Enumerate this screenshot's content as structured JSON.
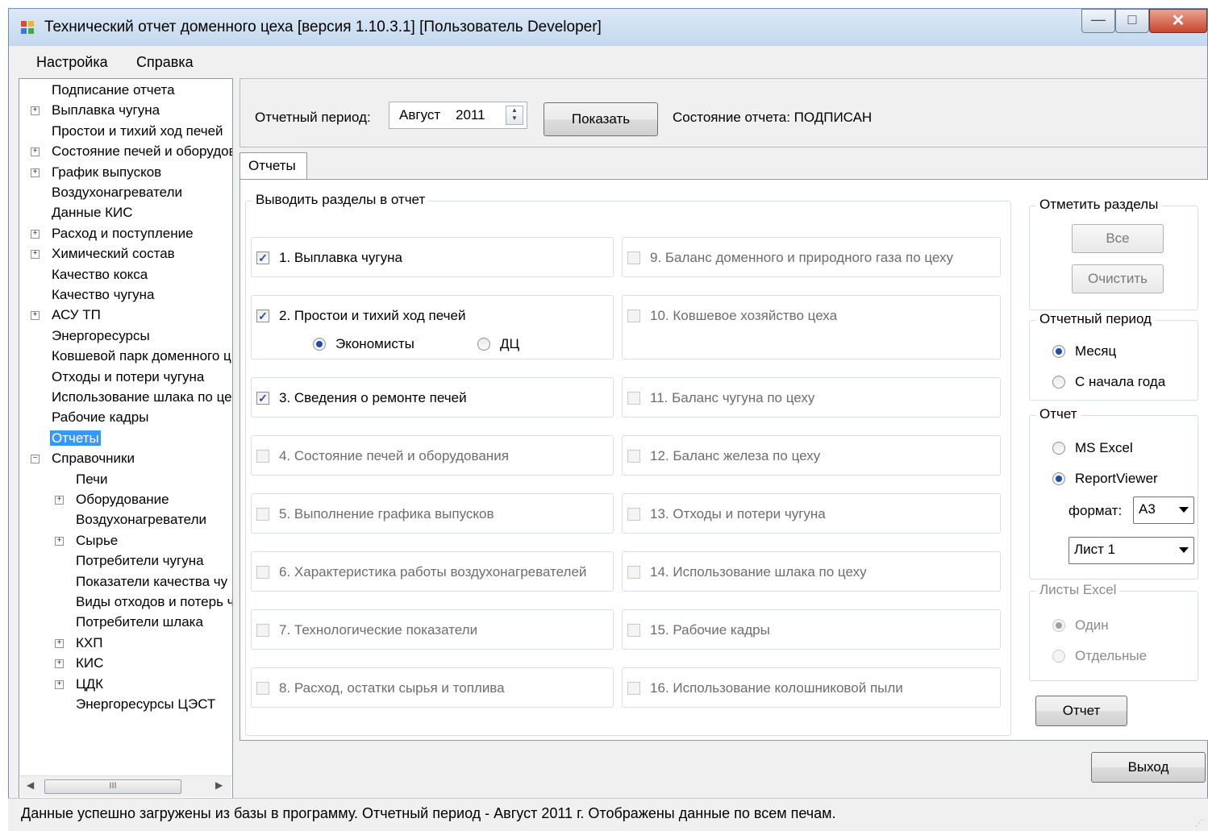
{
  "window": {
    "title": "Технический отчет доменного цеха [версия 1.10.3.1] [Пользователь Developer]",
    "controls": {
      "minimize": "—",
      "maximize": "□",
      "close": "✕"
    }
  },
  "menu": [
    "Настройка",
    "Справка"
  ],
  "tree": {
    "nodes": [
      {
        "label": "Подписание отчета",
        "expander": ""
      },
      {
        "label": "Выплавка чугуна",
        "expander": "+"
      },
      {
        "label": "Простои и тихий ход печей",
        "expander": ""
      },
      {
        "label": "Состояние печей и оборудова",
        "expander": "+"
      },
      {
        "label": "График выпусков",
        "expander": "+"
      },
      {
        "label": "Воздухонагреватели",
        "expander": ""
      },
      {
        "label": "Данные КИС",
        "expander": ""
      },
      {
        "label": "Расход и поступление",
        "expander": "+"
      },
      {
        "label": "Химический состав",
        "expander": "+"
      },
      {
        "label": "Качество кокса",
        "expander": ""
      },
      {
        "label": "Качество чугуна",
        "expander": ""
      },
      {
        "label": "АСУ ТП",
        "expander": "+"
      },
      {
        "label": "Энергоресурсы",
        "expander": ""
      },
      {
        "label": "Ковшевой парк доменного ц",
        "expander": ""
      },
      {
        "label": "Отходы и потери чугуна",
        "expander": ""
      },
      {
        "label": "Использование шлака по це",
        "expander": ""
      },
      {
        "label": "Рабочие кадры",
        "expander": ""
      },
      {
        "label": "Отчеты",
        "expander": "",
        "selected": true
      },
      {
        "label": "Справочники",
        "expander": "−"
      }
    ],
    "children": [
      {
        "label": "Печи",
        "expander": ""
      },
      {
        "label": "Оборудование",
        "expander": "+"
      },
      {
        "label": "Воздухонагреватели",
        "expander": ""
      },
      {
        "label": "Сырье",
        "expander": "+"
      },
      {
        "label": "Потребители чугуна",
        "expander": ""
      },
      {
        "label": "Показатели качества чу",
        "expander": ""
      },
      {
        "label": "Виды отходов и потерь ч",
        "expander": ""
      },
      {
        "label": "Потребители шлака",
        "expander": ""
      },
      {
        "label": "КХП",
        "expander": "+"
      },
      {
        "label": "КИС",
        "expander": "+"
      },
      {
        "label": "ЦДК",
        "expander": "+"
      },
      {
        "label": "Энергоресурсы ЦЭСТ",
        "expander": ""
      }
    ],
    "scroll": {
      "left": "◀",
      "right": "▶",
      "thumb": "III"
    }
  },
  "top": {
    "period_label": "Отчетный период:",
    "period_month": "Август",
    "period_year": "2011",
    "show_button": "Показать",
    "status": "Состояние отчета: ПОДПИСАН"
  },
  "tab_label": "Отчеты",
  "sections": {
    "title": "Выводить разделы в отчет",
    "left": [
      {
        "text": "1. Выплавка чугуна",
        "checked": true,
        "enabled": true
      },
      {
        "text": "2. Простои и тихий ход печей",
        "checked": true,
        "enabled": true
      },
      {
        "text": "3. Сведения о ремонте печей",
        "checked": true,
        "enabled": true
      },
      {
        "text": "4. Состояние печей и оборудования",
        "checked": false,
        "enabled": false
      },
      {
        "text": "5. Выполнение графика выпусков",
        "checked": false,
        "enabled": false
      },
      {
        "text": "6. Характеристика работы воздухонагревателей",
        "checked": false,
        "enabled": false
      },
      {
        "text": "7. Технологические показатели",
        "checked": false,
        "enabled": false
      },
      {
        "text": "8. Расход, остатки сырья и топлива",
        "checked": false,
        "enabled": false
      }
    ],
    "right": [
      {
        "text": "9. Баланс доменного и природного газа по цеху"
      },
      {
        "text": "10. Ковшевое хозяйство цеха"
      },
      {
        "text": "11. Баланс чугуна по цеху"
      },
      {
        "text": "12. Баланс железа по цеху"
      },
      {
        "text": "13. Отходы и потери чугуна"
      },
      {
        "text": "14. Использование шлака по цеху"
      },
      {
        "text": "15. Рабочие кадры"
      },
      {
        "text": "16. Использование колошниковой пыли"
      }
    ],
    "downtime_options": {
      "economists": "Экономисты",
      "dc": "ДЦ",
      "selected": "economists"
    }
  },
  "mark_sections": {
    "title": "Отметить разделы",
    "all": "Все",
    "clear": "Очистить"
  },
  "report_period": {
    "title": "Отчетный период",
    "month": "Месяц",
    "year_start": "С начала года",
    "selected": "month"
  },
  "report": {
    "title": "Отчет",
    "excel": "MS Excel",
    "viewer": "ReportViewer",
    "selected": "viewer",
    "format_label": "формат:",
    "format_value": "А3",
    "sheet_value": "Лист 1"
  },
  "excel_sheets": {
    "title": "Листы Excel",
    "one": "Один",
    "separate": "Отдельные",
    "selected": "one"
  },
  "report_button": "Отчет",
  "exit_button": "Выход",
  "status_bar": "Данные успешно загружены из базы в программу. Отчетный период - Август 2011 г. Отображены данные по  всем печам.",
  "colors": {
    "selection": "#3399ff",
    "title_bar": "#c4d8ee",
    "close_button": "#c8452c"
  }
}
